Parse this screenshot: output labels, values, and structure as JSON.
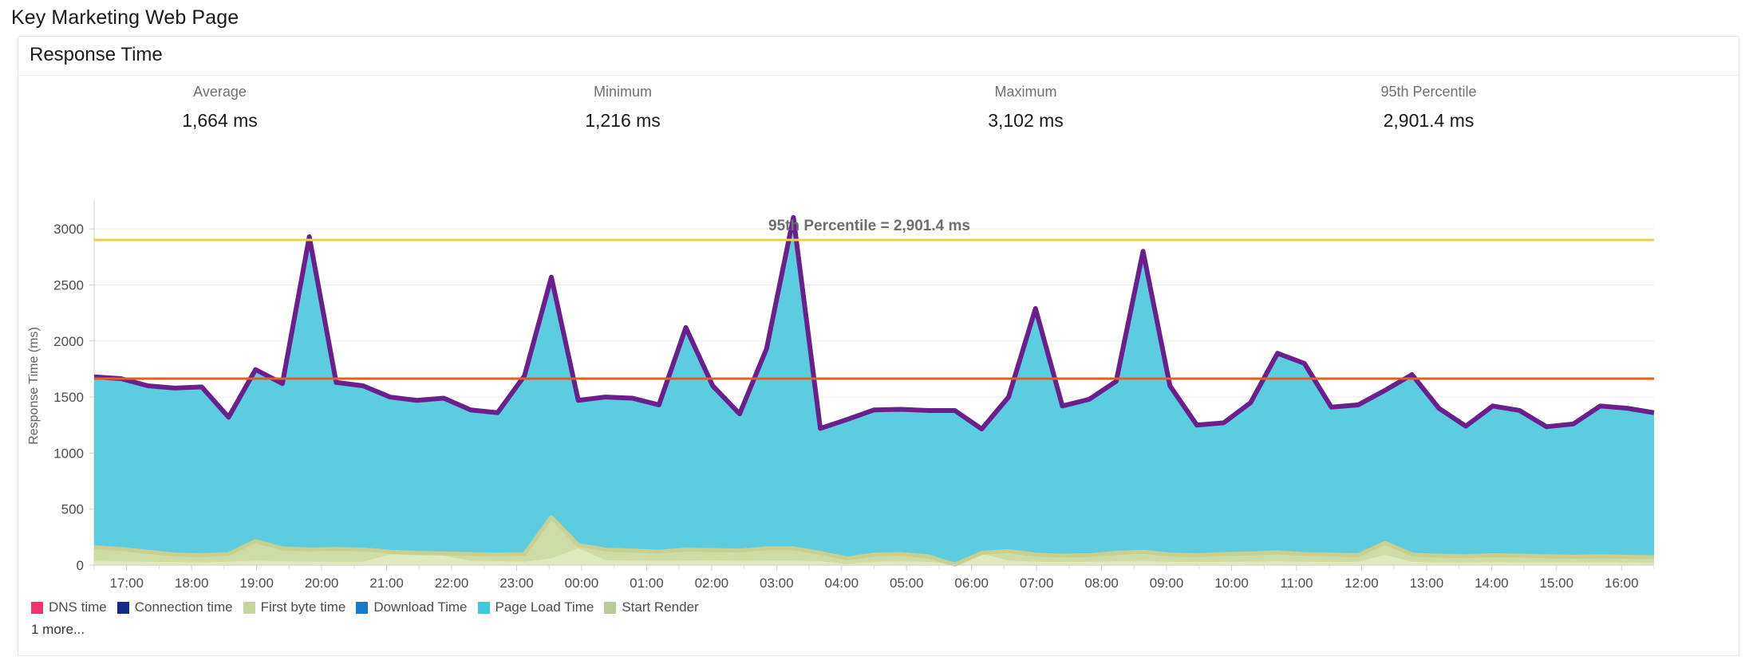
{
  "page": {
    "title": "Key Marketing Web Page"
  },
  "card": {
    "title": "Response Time"
  },
  "stats": [
    {
      "label": "Average",
      "value": "1,664 ms"
    },
    {
      "label": "Minimum",
      "value": "1,216 ms"
    },
    {
      "label": "Maximum",
      "value": "3,102 ms"
    },
    {
      "label": "95th Percentile",
      "value": "2,901.4 ms"
    }
  ],
  "legend": {
    "items": [
      {
        "label": "DNS time",
        "color": "#f6316b"
      },
      {
        "label": "Connection time",
        "color": "#122a8c"
      },
      {
        "label": "First byte time",
        "color": "#c3d69b"
      },
      {
        "label": "Download Time",
        "color": "#1479d1"
      },
      {
        "label": "Page Load Time",
        "color": "#3fc8de"
      },
      {
        "label": "Start Render",
        "color": "#b9cb9b"
      }
    ],
    "more_label": "1 more..."
  },
  "colors": {
    "page_load_fill": "#5ccce0",
    "page_load_stroke": "#6b1f8c",
    "first_byte_fill": "#dfeabf",
    "start_render_stroke": "#c9cf8e",
    "percentile_line": "#f0d03c",
    "average_line": "#e2601b",
    "grid": "#ebebeb",
    "axis": "#cfcfcf"
  },
  "chart_data": {
    "type": "area",
    "title": "Response Time",
    "xlabel": "",
    "ylabel": "Response Time (ms)",
    "ylim": [
      0,
      3200
    ],
    "grid": true,
    "legend_position": "bottom",
    "annotations": [
      {
        "text": "95th Percentile = 2,901.4 ms",
        "x": "03:20",
        "y": 2901.4
      }
    ],
    "reference_lines": [
      {
        "name": "95th Percentile",
        "value": 2901.4,
        "color": "#f0d03c"
      },
      {
        "name": "Average",
        "value": 1664,
        "color": "#e2601b"
      }
    ],
    "categories": [
      "16:40",
      "17:00",
      "17:20",
      "17:40",
      "18:00",
      "18:20",
      "18:40",
      "19:00",
      "19:20",
      "19:40",
      "20:00",
      "20:20",
      "20:40",
      "21:00",
      "21:20",
      "21:40",
      "22:00",
      "22:20",
      "22:40",
      "23:00",
      "23:20",
      "23:40",
      "00:00",
      "00:20",
      "00:40",
      "01:00",
      "01:20",
      "01:40",
      "02:00",
      "02:20",
      "02:40",
      "03:00",
      "03:20",
      "03:40",
      "04:00",
      "04:20",
      "04:40",
      "05:00",
      "05:20",
      "05:40",
      "06:00",
      "06:20",
      "06:40",
      "07:00",
      "07:20",
      "07:40",
      "08:00",
      "08:20",
      "08:40",
      "09:00",
      "09:20",
      "09:40",
      "10:00",
      "10:20",
      "10:40",
      "11:00",
      "11:20",
      "11:40",
      "12:00",
      "12:20",
      "12:40",
      "13:00",
      "13:20",
      "13:40",
      "14:00",
      "14:20",
      "14:40",
      "15:00",
      "15:20",
      "15:40",
      "16:00"
    ],
    "xtick_labels": [
      "17:00",
      "18:00",
      "19:00",
      "20:00",
      "21:00",
      "22:00",
      "23:00",
      "00:00",
      "01:00",
      "02:00",
      "03:00",
      "04:00",
      "05:00",
      "06:00",
      "07:00",
      "08:00",
      "09:00",
      "10:00",
      "11:00",
      "12:00",
      "13:00",
      "14:00",
      "15:00",
      "16:00"
    ],
    "ytick_labels": [
      "0",
      "500",
      "1000",
      "1500",
      "2000",
      "2500",
      "3000"
    ],
    "series": [
      {
        "name": "Page Load Time",
        "color": "#5ccce0",
        "values": [
          1680,
          1664,
          1600,
          1580,
          1590,
          1320,
          1745,
          1620,
          2930,
          1630,
          1600,
          1500,
          1470,
          1490,
          1385,
          1360,
          1690,
          2570,
          1470,
          1500,
          1490,
          1430,
          2120,
          1600,
          1350,
          1930,
          3102,
          1220,
          1300,
          1385,
          1390,
          1380,
          1380,
          1215,
          1500,
          2290,
          1420,
          1480,
          1640,
          2800,
          1600,
          1250,
          1270,
          1450,
          1890,
          1800,
          1410,
          1430,
          1560,
          1700,
          1400,
          1240,
          1420,
          1380,
          1235,
          1260,
          1420,
          1400,
          1360
        ]
      },
      {
        "name": "Start Render",
        "color": "#c9cf8e",
        "values": [
          160,
          145,
          120,
          95,
          90,
          100,
          215,
          150,
          140,
          145,
          140,
          120,
          110,
          105,
          100,
          95,
          100,
          430,
          180,
          140,
          130,
          120,
          140,
          135,
          130,
          150,
          150,
          110,
          60,
          95,
          100,
          80,
          5,
          110,
          125,
          95,
          85,
          90,
          110,
          120,
          95,
          90,
          100,
          105,
          115,
          100,
          95,
          90,
          200,
          95,
          85,
          80,
          90,
          85,
          80,
          75,
          80,
          75,
          70
        ]
      },
      {
        "name": "First byte time",
        "color": "#dfeabf",
        "values": [
          40,
          35,
          30,
          28,
          25,
          30,
          40,
          35,
          32,
          30,
          30,
          95,
          90,
          85,
          40,
          35,
          32,
          60,
          150,
          45,
          40,
          38,
          40,
          42,
          38,
          40,
          40,
          35,
          10,
          30,
          35,
          30,
          3,
          105,
          40,
          30,
          28,
          30,
          35,
          38,
          30,
          28,
          30,
          32,
          35,
          30,
          28,
          30,
          90,
          30,
          25,
          25,
          28,
          25,
          24,
          22,
          25,
          22,
          20
        ]
      }
    ]
  }
}
